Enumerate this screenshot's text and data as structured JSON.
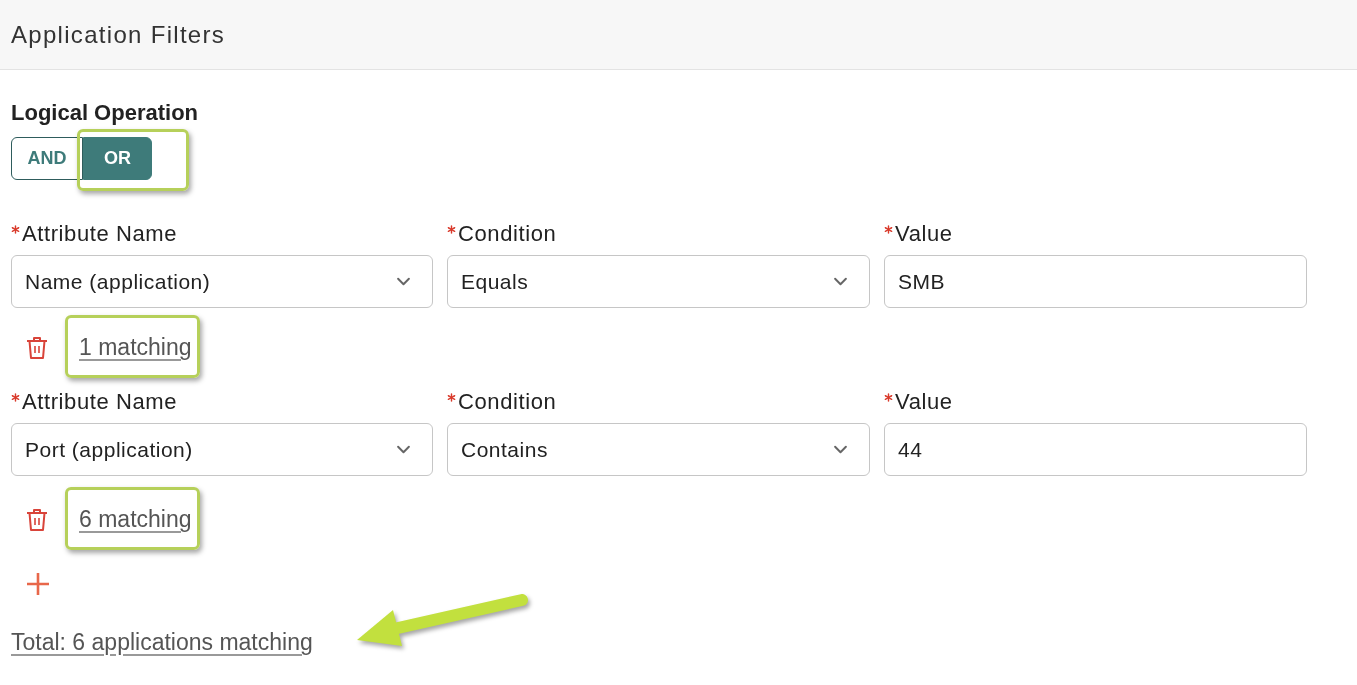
{
  "header": {
    "title": "Application Filters"
  },
  "logical_operation": {
    "label": "Logical Operation",
    "options": [
      {
        "label": "AND",
        "selected": false,
        "highlighted": false
      },
      {
        "label": "OR",
        "selected": true,
        "highlighted": true
      }
    ]
  },
  "filters": [
    {
      "fields": [
        {
          "kind": "select",
          "label": "Attribute Name",
          "required": true,
          "value": "Name (application)"
        },
        {
          "kind": "select",
          "label": "Condition",
          "required": true,
          "value": "Equals"
        },
        {
          "kind": "text",
          "label": "Value",
          "required": true,
          "value": "SMB"
        }
      ],
      "match_count": {
        "text": "1 matching",
        "highlighted": true
      }
    },
    {
      "fields": [
        {
          "kind": "select",
          "label": "Attribute Name",
          "required": true,
          "value": "Port (application)"
        },
        {
          "kind": "select",
          "label": "Condition",
          "required": true,
          "value": "Contains"
        },
        {
          "kind": "text",
          "label": "Value",
          "required": true,
          "value": "44"
        }
      ],
      "match_count": {
        "text": "6 matching",
        "highlighted": true
      }
    }
  ],
  "total": {
    "text": "Total: 6 applications matching",
    "arrow": true
  }
}
